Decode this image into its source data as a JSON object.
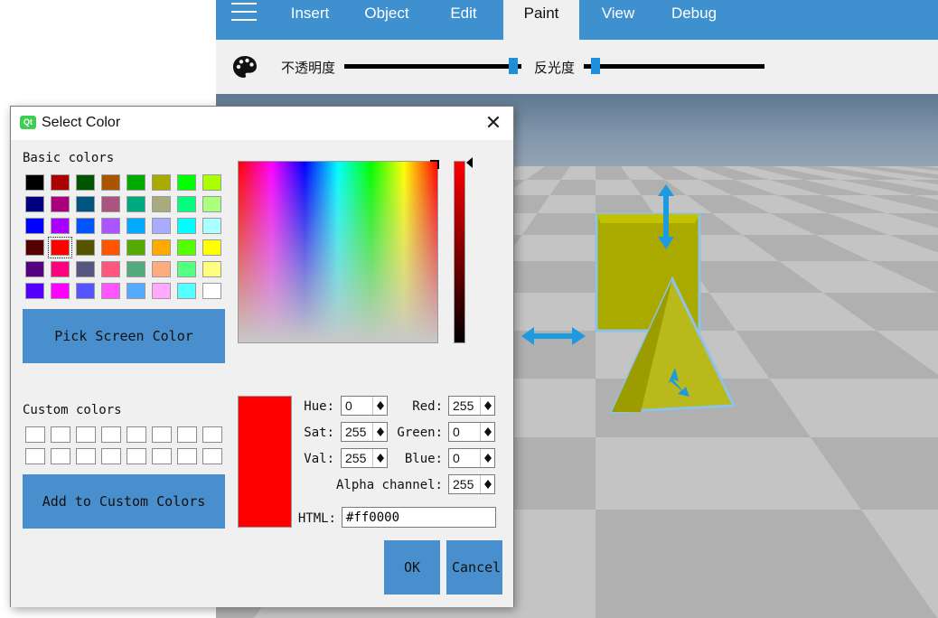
{
  "app": {
    "menu": {
      "items": [
        {
          "label": "Insert",
          "active": false
        },
        {
          "label": "Object",
          "active": false
        },
        {
          "label": "Edit",
          "active": false
        },
        {
          "label": "Paint",
          "active": true
        },
        {
          "label": "View",
          "active": false
        },
        {
          "label": "Debug",
          "active": false
        }
      ],
      "icon": "hamburger-menu-icon"
    },
    "toolbar": {
      "icon": "palette-icon",
      "opacity_label": "不透明度",
      "opacity_value": 0.98,
      "reflectance_label": "反光度",
      "reflectance_value": 0.04
    },
    "colors": {
      "accent": "#3f90ce",
      "slider_handle": "#1e8fd8",
      "button": "#4a8fcd"
    }
  },
  "dialog": {
    "title": "Select Color",
    "icon": "qt-logo-icon",
    "icon_text": "Qt",
    "close_icon": "close-icon",
    "basic_colors_label": "Basic colors",
    "basic_colors": [
      [
        "#000000",
        "#aa0000",
        "#005500",
        "#aa5500",
        "#00aa00",
        "#aaaa00",
        "#00ff00",
        "#aaff00"
      ],
      [
        "#00007f",
        "#aa007f",
        "#00557f",
        "#aa557f",
        "#00aa7f",
        "#aaaa7f",
        "#00ff7f",
        "#aaff7f"
      ],
      [
        "#0000ff",
        "#aa00ff",
        "#0055ff",
        "#aa55ff",
        "#00aaff",
        "#aaaaff",
        "#00ffff",
        "#aaffff"
      ],
      [
        "#550000",
        "#ff0000",
        "#555500",
        "#ff5500",
        "#55aa00",
        "#ffaa00",
        "#55ff00",
        "#ffff00"
      ],
      [
        "#55007f",
        "#ff007f",
        "#55557f",
        "#ff557f",
        "#55aa7f",
        "#ffaa7f",
        "#55ff7f",
        "#ffff7f"
      ],
      [
        "#5500ff",
        "#ff00ff",
        "#5555ff",
        "#ff55ff",
        "#55aaff",
        "#ffaaff",
        "#55ffff",
        "#ffffff"
      ]
    ],
    "selected_swatch": "#ff0000",
    "pick_screen_label": "Pick Screen Color",
    "custom_colors_label": "Custom colors",
    "add_custom_label": "Add to Custom Colors",
    "current_color": "#ff0000",
    "fields": {
      "hue_label": "Hue:",
      "hue": "0",
      "sat_label": "Sat:",
      "sat": "255",
      "val_label": "Val:",
      "val": "255",
      "red_label": "Red:",
      "red": "255",
      "green_label": "Green:",
      "green": "0",
      "blue_label": "Blue:",
      "blue": "0",
      "alpha_label": "Alpha channel:",
      "alpha": "255",
      "html_label": "HTML:",
      "html": "#ff0000"
    },
    "ok_label": "OK",
    "cancel_label": "Cancel"
  },
  "scene": {
    "object_color": "#b4b400",
    "gizmo_color": "#1e9be0",
    "gizmo_icon": "move-arrows-icon"
  }
}
